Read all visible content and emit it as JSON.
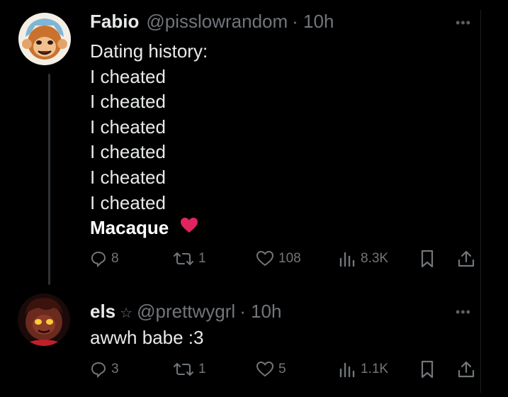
{
  "tweets": [
    {
      "display_name": "Fabio",
      "handle": "@pisslowrandom",
      "time": "· 10h",
      "more_icon": "more-dots-icon",
      "lines": [
        "Dating history:",
        "I cheated",
        "I cheated",
        "I cheated",
        "I cheated",
        "I cheated",
        "I cheated"
      ],
      "last_line": "Macaque",
      "emoji": "red-heart",
      "stats": {
        "replies": "8",
        "retweets": "1",
        "likes": "108",
        "views": "8.3K"
      }
    },
    {
      "display_name": "els",
      "star": "☆",
      "handle": "@prettwygrl",
      "time": "· 10h",
      "more_icon": "more-dots-icon",
      "lines": [
        "awwh babe :3"
      ],
      "stats": {
        "replies": "3",
        "retweets": "1",
        "likes": "5",
        "views": "1.1K"
      }
    }
  ],
  "colors": {
    "background": "#000000",
    "text": "#e7e9ea",
    "muted": "#71767b",
    "heart": "#e0245e"
  }
}
